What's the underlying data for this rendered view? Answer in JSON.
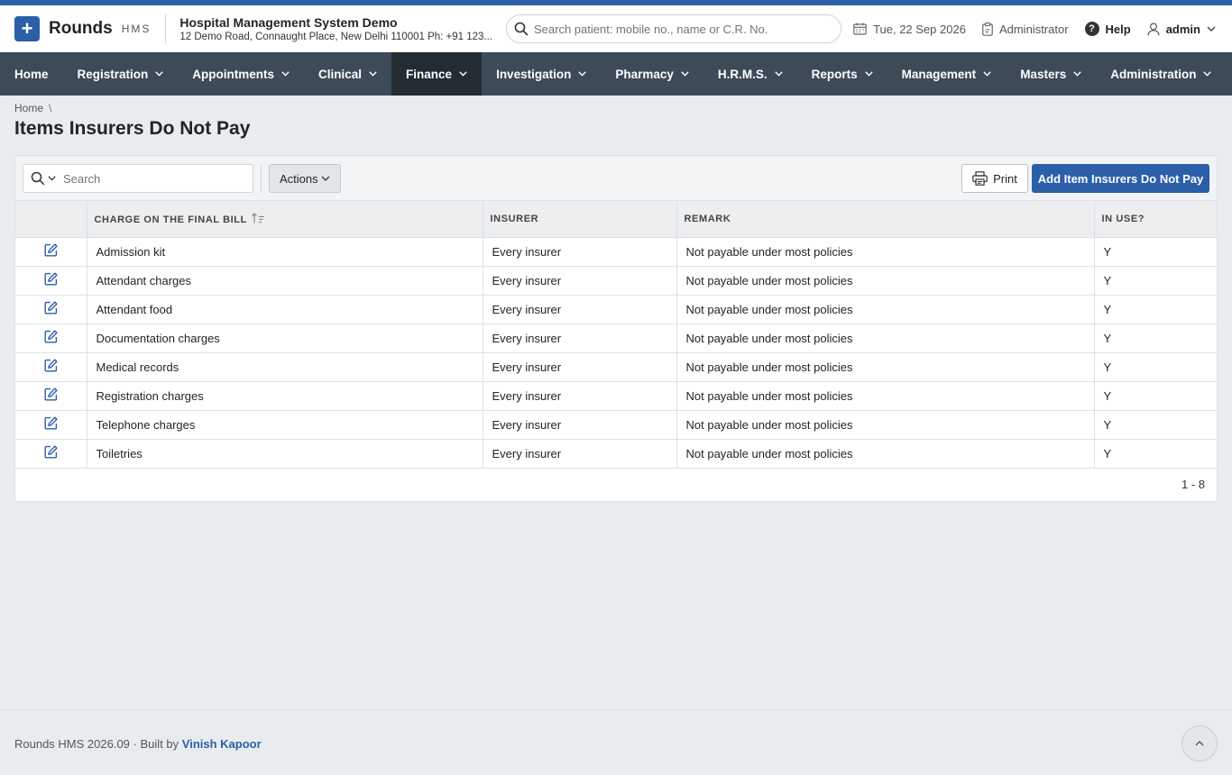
{
  "brand": {
    "name": "Rounds",
    "sub": "HMS",
    "logo_glyph": "+"
  },
  "hospital": {
    "name": "Hospital Management System Demo",
    "address": "12 Demo Road, Connaught Place, New Delhi 110001 Ph: +91 123..."
  },
  "patient_search": {
    "placeholder": "Search patient: mobile no., name or C.R. No."
  },
  "header": {
    "date": "Tue, 22 Sep 2026",
    "role": "Administrator",
    "help": "Help",
    "user": "admin"
  },
  "nav": {
    "items": [
      {
        "label": "Home"
      },
      {
        "label": "Registration"
      },
      {
        "label": "Appointments"
      },
      {
        "label": "Clinical"
      },
      {
        "label": "Finance",
        "active": true
      },
      {
        "label": "Investigation"
      },
      {
        "label": "Pharmacy"
      },
      {
        "label": "H.R.M.S."
      },
      {
        "label": "Reports"
      },
      {
        "label": "Management"
      },
      {
        "label": "Masters"
      },
      {
        "label": "Administration"
      }
    ]
  },
  "breadcrumb": {
    "home": "Home",
    "separator": "\\"
  },
  "page": {
    "title": "Items Insurers Do Not Pay"
  },
  "toolbar": {
    "search_placeholder": "Search",
    "actions": "Actions",
    "print": "Print",
    "add": "Add Item Insurers Do Not Pay"
  },
  "table": {
    "columns": [
      "CHARGE ON THE FINAL BILL",
      "INSURER",
      "REMARK",
      "IN USE?"
    ],
    "rows": [
      {
        "charge": "Admission kit",
        "insurer": "Every insurer",
        "remark": "Not payable under most policies",
        "in_use": "Y"
      },
      {
        "charge": "Attendant charges",
        "insurer": "Every insurer",
        "remark": "Not payable under most policies",
        "in_use": "Y"
      },
      {
        "charge": "Attendant food",
        "insurer": "Every insurer",
        "remark": "Not payable under most policies",
        "in_use": "Y"
      },
      {
        "charge": "Documentation charges",
        "insurer": "Every insurer",
        "remark": "Not payable under most policies",
        "in_use": "Y"
      },
      {
        "charge": "Medical records",
        "insurer": "Every insurer",
        "remark": "Not payable under most policies",
        "in_use": "Y"
      },
      {
        "charge": "Registration charges",
        "insurer": "Every insurer",
        "remark": "Not payable under most policies",
        "in_use": "Y"
      },
      {
        "charge": "Telephone charges",
        "insurer": "Every insurer",
        "remark": "Not payable under most policies",
        "in_use": "Y"
      },
      {
        "charge": "Toiletries",
        "insurer": "Every insurer",
        "remark": "Not payable under most policies",
        "in_use": "Y"
      }
    ],
    "pager": "1 - 8"
  },
  "footer": {
    "version": "Rounds HMS 2026.09",
    "dot": "·",
    "built_by": "Built by",
    "author": "Vinish Kapoor"
  },
  "colors": {
    "primary": "#2b5fa8",
    "nav_bg": "#3d4a57",
    "nav_active": "#232b33",
    "page_bg": "#e9ecef"
  }
}
